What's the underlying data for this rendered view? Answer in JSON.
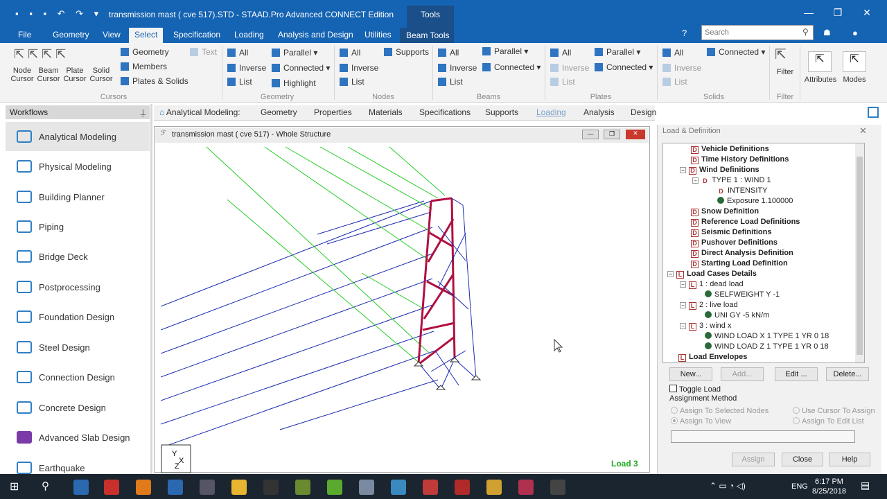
{
  "window": {
    "title": "transmission mast ( cve 517).STD - STAAD.Pro Advanced CONNECT Edition",
    "context_tab": "Tools"
  },
  "menu": {
    "tabs": [
      "File",
      "Geometry",
      "View",
      "Select",
      "Specification",
      "Loading",
      "Analysis and Design",
      "Utilities",
      "Beam Tools"
    ],
    "search_placeholder": "Search"
  },
  "ribbon": {
    "cursors": {
      "items": [
        "Node Cursor",
        "Beam Cursor",
        "Plate Cursor",
        "Solid Cursor"
      ],
      "sub": [
        "Geometry",
        "Members",
        "Plates & Solids"
      ],
      "text": "Text",
      "group": "Cursors"
    },
    "geometry": {
      "items": [
        "All",
        "Inverse",
        "List",
        "Parallel",
        "Connected",
        "Highlight"
      ],
      "group": "Geometry"
    },
    "nodes": {
      "items": [
        "All",
        "Inverse",
        "List",
        "Supports"
      ],
      "group": "Nodes"
    },
    "beams": {
      "items": [
        "All",
        "Inverse",
        "List",
        "Parallel",
        "Connected"
      ],
      "group": "Beams"
    },
    "plates": {
      "items": [
        "All",
        "Inverse",
        "List",
        "Parallel",
        "Connected"
      ],
      "group": "Plates"
    },
    "solids": {
      "items": [
        "All",
        "Inverse",
        "List",
        "Connected"
      ],
      "group": "Solids"
    },
    "filter": {
      "label": "Filter",
      "group": "Filter"
    },
    "attributes": "Attributes",
    "modes": "Modes"
  },
  "workflows": {
    "title": "Workflows",
    "items": [
      "Analytical Modeling",
      "Physical Modeling",
      "Building Planner",
      "Piping",
      "Bridge Deck",
      "Postprocessing",
      "Foundation Design",
      "Steel Design",
      "Connection Design",
      "Concrete Design",
      "Advanced Slab Design",
      "Earthquake"
    ]
  },
  "navbar": {
    "items": [
      "Analytical Modeling:",
      "Geometry",
      "Properties",
      "Materials",
      "Specifications",
      "Supports",
      "Loading",
      "Analysis",
      "Design"
    ]
  },
  "viewport": {
    "title": "transmission mast ( cve 517) - Whole Structure",
    "load_label": "Load 3"
  },
  "load_panel": {
    "title": "Load & Definition",
    "tree": [
      "Vehicle Definitions",
      "Time History Definitions",
      "Wind Definitions",
      "TYPE 1 : WIND 1",
      "INTENSITY",
      "Exposure 1.100000",
      "Snow Definition",
      "Reference Load Definitions",
      "Seismic Definitions",
      "Pushover Definitions",
      "Direct Analysis Definition",
      "Starting Load Definition",
      "Load Cases Details",
      "1 : dead load",
      "SELFWEIGHT Y -1",
      "2 : live load",
      "UNI GY -5 kN/m",
      "3 : wind x",
      "WIND LOAD X 1 TYPE 1 YR 0 18",
      "WIND LOAD Z 1 TYPE 1 YR 0 18",
      "Load Envelopes"
    ],
    "buttons": [
      "New...",
      "Add...",
      "Edit ...",
      "Delete..."
    ],
    "toggle": "Toggle Load",
    "assign_method": "Assignment Method",
    "radios": [
      "Assign To Selected Nodes",
      "Use Cursor To Assign",
      "Assign To View",
      "Assign To Edit List"
    ],
    "bottom": [
      "Assign",
      "Close",
      "Help"
    ]
  },
  "taskbar": {
    "lang": "ENG",
    "time": "6:17 PM",
    "date": "8/25/2018"
  },
  "colors": {
    "title_blue": "#1563b3",
    "member_red": "#b01040",
    "member_blue": "#1a2ab0",
    "load_green": "#22cc22"
  }
}
